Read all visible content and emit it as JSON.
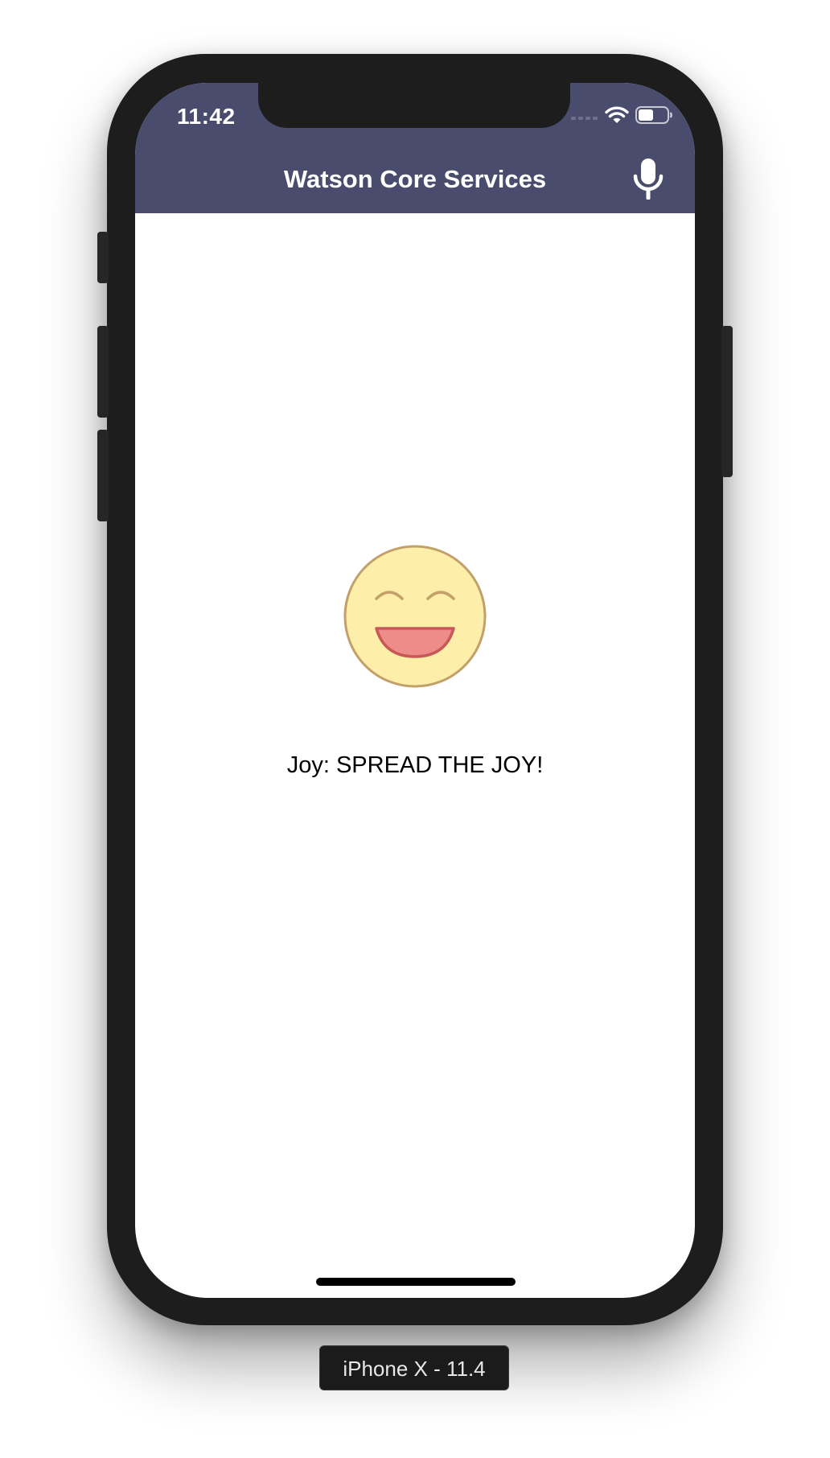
{
  "status_bar": {
    "time": "11:42",
    "icons": [
      "cellular-signal-icon",
      "wifi-icon",
      "battery-icon"
    ]
  },
  "navbar": {
    "title": "Watson Core Services",
    "mic_icon": "microphone-icon",
    "background": "#4a4c6e"
  },
  "content": {
    "emoji_icon": "smiling-face-icon",
    "caption": "Joy: SPREAD THE JOY!"
  },
  "simulator": {
    "device_label": "iPhone X - 11.4"
  },
  "colors": {
    "navbar": "#4a4c6e",
    "emoji_fill": "#fdeeaa",
    "emoji_stroke": "#c2a06a",
    "mouth_fill": "#ee8c89",
    "mouth_stroke": "#c65858"
  }
}
